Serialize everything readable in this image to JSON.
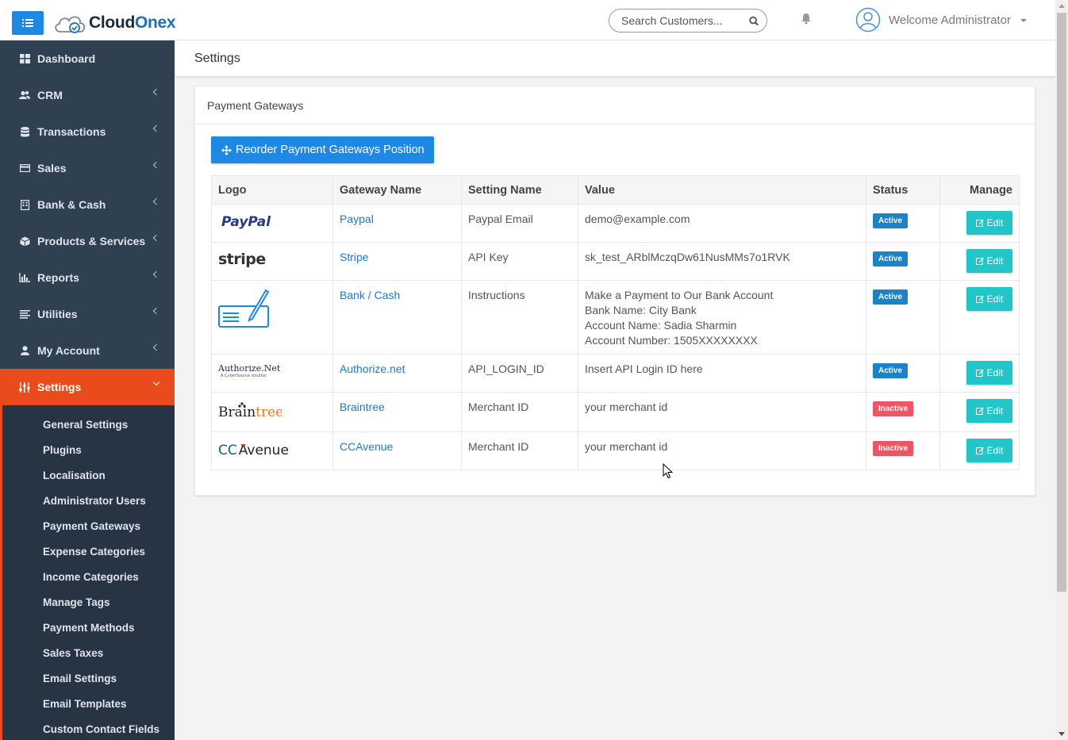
{
  "app": {
    "brand_part1": "Cloud",
    "brand_part2": "Onex",
    "accent_color": "#1e88e5",
    "active_color": "#ea4b1c",
    "sidebar_color": "#2f4050"
  },
  "topbar": {
    "search_placeholder": "Search Customers...",
    "welcome": "Welcome Administrator"
  },
  "sidebar": {
    "items": [
      {
        "label": "Dashboard",
        "icon": "dashboard-icon"
      },
      {
        "label": "CRM",
        "icon": "users-icon"
      },
      {
        "label": "Transactions",
        "icon": "database-icon"
      },
      {
        "label": "Sales",
        "icon": "credit-card-icon"
      },
      {
        "label": "Bank & Cash",
        "icon": "building-icon"
      },
      {
        "label": "Products & Services",
        "icon": "cube-icon"
      },
      {
        "label": "Reports",
        "icon": "bar-chart-icon"
      },
      {
        "label": "Utilities",
        "icon": "list-icon"
      },
      {
        "label": "My Account",
        "icon": "user-icon"
      },
      {
        "label": "Settings",
        "icon": "sliders-icon"
      }
    ],
    "submenu": [
      "General Settings",
      "Plugins",
      "Localisation",
      "Administrator Users",
      "Payment Gateways",
      "Expense Categories",
      "Income Categories",
      "Manage Tags",
      "Payment Methods",
      "Sales Taxes",
      "Email Settings",
      "Email Templates",
      "Custom Contact Fields"
    ]
  },
  "page": {
    "title": "Settings",
    "panel_title": "Payment Gateways",
    "reorder_label": "Reorder Payment Gateways Position"
  },
  "table": {
    "headers": [
      "Logo",
      "Gateway Name",
      "Setting Name",
      "Value",
      "Status",
      "Manage"
    ],
    "edit_label": "Edit",
    "rows": [
      {
        "logo": "paypal-logo",
        "logo_text": "PayPal",
        "gateway": "Paypal",
        "setting": "Paypal Email",
        "value": [
          "demo@example.com"
        ],
        "status": "Active"
      },
      {
        "logo": "stripe-logo",
        "logo_text": "stripe",
        "gateway": "Stripe",
        "setting": "API Key",
        "value": [
          "sk_test_ARblMczqDw61NusMMs7o1RVK"
        ],
        "status": "Active"
      },
      {
        "logo": "bank-cash-logo",
        "gateway": "Bank / Cash",
        "setting": "Instructions",
        "value": [
          "Make a Payment to Our Bank Account",
          "Bank Name: City Bank",
          "Account Name: Sadia Sharmin",
          "Account Number: 1505XXXXXXXX"
        ],
        "status": "Active"
      },
      {
        "logo": "authorize-net-logo",
        "logo_text": "Authorize.Net",
        "logo_subtext": "A CyberSource solution",
        "gateway": "Authorize.net",
        "setting": "API_LOGIN_ID",
        "value": [
          "Insert API Login ID here"
        ],
        "status": "Active"
      },
      {
        "logo": "braintree-logo",
        "logo_text_1": "Brain",
        "logo_text_2": "tree",
        "gateway": "Braintree",
        "setting": "Merchant ID",
        "value": [
          "your merchant id"
        ],
        "status": "Inactive"
      },
      {
        "logo": "ccavenue-logo",
        "logo_text_1": "CC",
        "logo_text_2": "Avenue",
        "gateway": "CCAvenue",
        "setting": "Merchant ID",
        "value": [
          "your merchant id"
        ],
        "status": "Inactive"
      }
    ]
  }
}
